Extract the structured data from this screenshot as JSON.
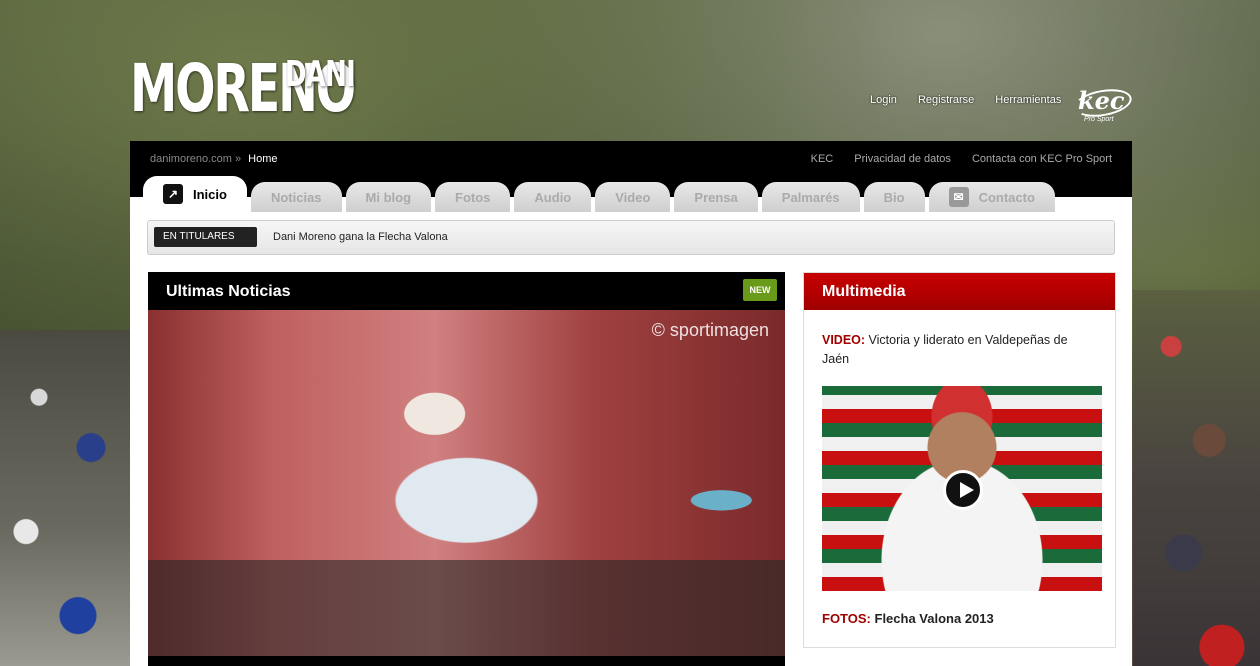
{
  "brand": {
    "surname": "MORENO",
    "name": "DANI"
  },
  "header_links": [
    "Login",
    "Registrarse",
    "Herramientas"
  ],
  "partner_logo": {
    "text": "kec",
    "sub": "Pro Sport"
  },
  "breadcrumb": {
    "site": "danimoreno.com »",
    "current": "Home"
  },
  "utility_links": [
    "KEC",
    "Privacidad de datos",
    "Contacta con KEC Pro Sport"
  ],
  "tabs": [
    {
      "label": "Inicio",
      "icon": "home-icon",
      "active": true
    },
    {
      "label": "Noticias"
    },
    {
      "label": "Mi blog"
    },
    {
      "label": "Fotos"
    },
    {
      "label": "Audio"
    },
    {
      "label": "Video"
    },
    {
      "label": "Prensa"
    },
    {
      "label": "Palmarés"
    },
    {
      "label": "Bio"
    },
    {
      "label": "Contacto",
      "icon": "mail-icon"
    }
  ],
  "ticker": {
    "badge": "EN TITULARES",
    "text": "Dani Moreno gana la Flecha Valona"
  },
  "news": {
    "title": "Ultimas Noticias",
    "badge": "NEW",
    "photo_credit": "© sportimagen"
  },
  "multimedia": {
    "title": "Multimedia",
    "video_label": "VIDEO:",
    "video_text": "Victoria y liderato en Valdepeñas de Jaén",
    "fotos_label": "FOTOS:",
    "fotos_text": "Flecha Valona 2013"
  },
  "colors": {
    "accent_red": "#b00000",
    "new_green": "#6a9a1a"
  }
}
